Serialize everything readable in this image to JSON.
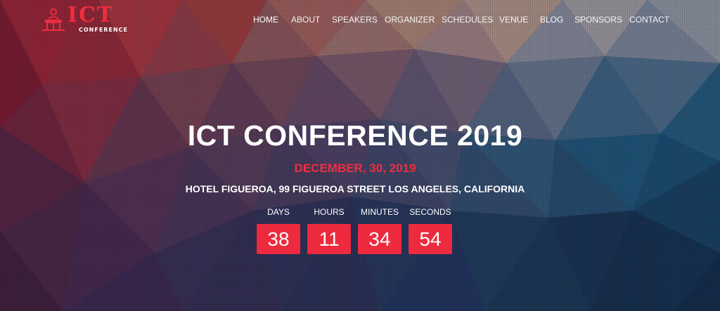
{
  "logo": {
    "title": "ICT",
    "subtitle": "CONFERENCE",
    "icon": "podium-speaker-icon",
    "accent_color": "#ed2d3f"
  },
  "nav": {
    "items": [
      {
        "label": "HOME",
        "active": true
      },
      {
        "label": "ABOUT",
        "active": false
      },
      {
        "label": "SPEAKERS",
        "active": false
      },
      {
        "label": "ORGANIZER",
        "active": false
      },
      {
        "label": "SCHEDULES",
        "active": false
      },
      {
        "label": "VENUE",
        "active": false
      },
      {
        "label": "BLOG",
        "active": false
      },
      {
        "label": "SPONSORS",
        "active": false
      },
      {
        "label": "CONTACT",
        "active": false
      }
    ]
  },
  "hero": {
    "title": "ICT CONFERENCE 2019",
    "date": "DECEMBER, 30, 2019",
    "location": "HOTEL FIGUEROA, 99 FIGUEROA STREET LOS ANGELES, CALIFORNIA",
    "date_color": "#ee2e40"
  },
  "countdown": {
    "box_color": "#ee2a3e",
    "units": [
      {
        "label": "DAYS",
        "value": "38"
      },
      {
        "label": "HOURS",
        "value": "11"
      },
      {
        "label": "MINUTES",
        "value": "34"
      },
      {
        "label": "SECONDS",
        "value": "54"
      }
    ]
  }
}
